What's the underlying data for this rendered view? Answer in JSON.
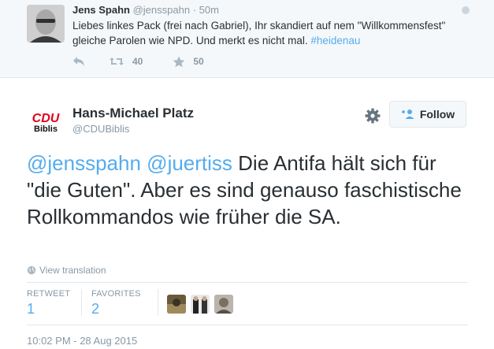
{
  "parent_tweet": {
    "author_name": "Jens Spahn",
    "author_handle": "@jensspahn",
    "separator": "·",
    "time": "50m",
    "text": "Liebes linkes Pack (frei nach Gabriel), Ihr skandiert auf nem \"Willkommensfest\" gleiche Parolen wie NPD. Und merkt es nicht mal. ",
    "hashtag": "#heidenau",
    "retweet_count": "40",
    "favorite_count": "50",
    "icons": [
      "reply-icon",
      "retweet-icon",
      "favorite-icon",
      "more-dot-icon"
    ]
  },
  "tweet": {
    "author_name": "Hans-Michael Platz",
    "author_handle": "@CDUBiblis",
    "avatar_logo": {
      "top": "CDU",
      "bottom": "Biblis",
      "top_color": "#e2001a",
      "bottom_color": "#111111"
    },
    "follow_label": "Follow",
    "mention_1": "@jensspahn",
    "mention_2": "@juertiss",
    "text": " Die Antifa hält sich für \"die Guten\". Aber es sind genauso faschistische Rollkommandos wie früher die SA.",
    "view_translation": "View translation",
    "retweets_label": "RETWEET",
    "retweets_value": "1",
    "favorites_label": "FAVORITES",
    "favorites_value": "2",
    "timestamp": "10:02 PM - 28 Aug 2015",
    "icons": [
      "gear-icon",
      "follow-person-icon",
      "globe-icon"
    ]
  },
  "colors": {
    "link": "#55acee",
    "muted": "#8899a6",
    "text": "#292f33",
    "border": "#e1e8ed",
    "parent_bg": "#f5f8fa"
  }
}
